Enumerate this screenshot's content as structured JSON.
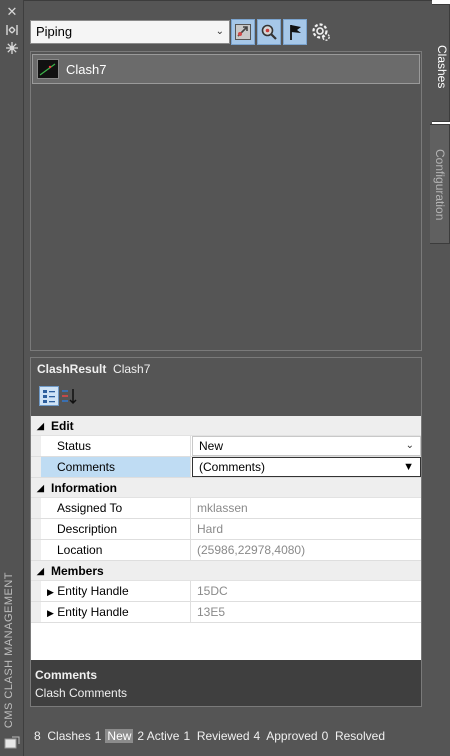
{
  "window": {
    "title": "CMS CLASH MANAGEMENT",
    "controls": [
      "close-icon",
      "auto-hide-icon",
      "properties-icon"
    ]
  },
  "toolbar": {
    "filter_value": "Piping",
    "buttons": [
      "zoom-to-clash-icon",
      "find-clash-icon",
      "flag-icon",
      "settings-icon"
    ]
  },
  "clash_list": {
    "items": [
      {
        "label": "Clash7"
      }
    ]
  },
  "properties": {
    "header_type": "ClashResult",
    "header_name": "Clash7",
    "categories": {
      "edit": "Edit",
      "information": "Information",
      "members": "Members"
    },
    "edit": {
      "status_label": "Status",
      "status_value": "New",
      "comments_label": "Comments",
      "comments_value": "(Comments)"
    },
    "information": {
      "assigned_label": "Assigned To",
      "assigned_value": "mklassen",
      "description_label": "Description",
      "description_value": "Hard",
      "location_label": "Location",
      "location_value": "(25986,22978,4080)"
    },
    "members": [
      {
        "label": "Entity Handle",
        "value": "15DC"
      },
      {
        "label": "Entity Handle",
        "value": "13E5"
      }
    ],
    "description_panel": {
      "title": "Comments",
      "text": "Clash Comments"
    }
  },
  "status_bar": {
    "clashes_count": "8",
    "clashes_label": "Clashes",
    "new_count": "1",
    "new_label": "New",
    "active_count": "2",
    "active_label": "Active",
    "reviewed_count": "1",
    "reviewed_label": "Reviewed",
    "approved_count": "4",
    "approved_label": "Approved",
    "resolved_count": "0",
    "resolved_label": "Resolved"
  },
  "tabs": {
    "clashes": "Clashes",
    "configuration": "Configuration"
  },
  "colors": {
    "panel_bg": "#555555",
    "selection_blue": "#bfdcf3",
    "button_blue": "#a6c7e8",
    "status_highlight": "#8c8c8c"
  }
}
